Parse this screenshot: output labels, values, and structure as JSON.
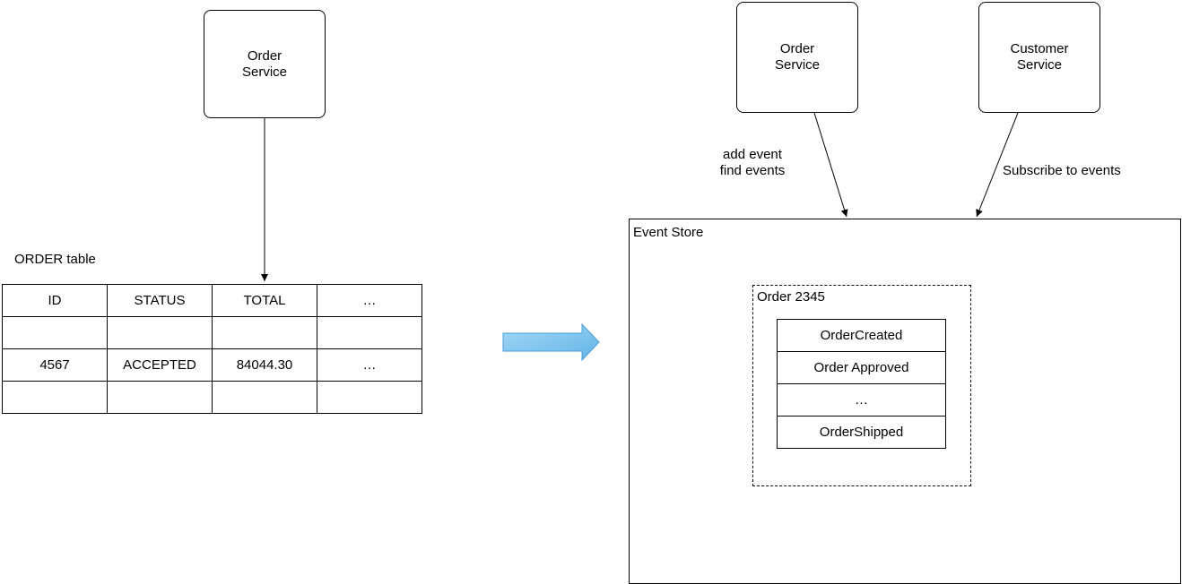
{
  "left": {
    "service": {
      "label": "Order\nService"
    },
    "table": {
      "caption": "ORDER table",
      "header": [
        "ID",
        "STATUS",
        "TOTAL",
        "…"
      ],
      "rows": [
        [
          "",
          "",
          "",
          ""
        ],
        [
          "4567",
          "ACCEPTED",
          "84044.30",
          "…"
        ],
        [
          "",
          "",
          "",
          ""
        ]
      ]
    }
  },
  "transition_arrow": {
    "fill": "#8ecdf3",
    "stroke": "#4a9fd6"
  },
  "right": {
    "order_service": {
      "label": "Order\nService"
    },
    "customer_service": {
      "label": "Customer\nService"
    },
    "edge_order_label": "add event\nfind events",
    "edge_customer_label": "Subscribe to events",
    "event_store": {
      "title": "Event Store",
      "aggregate": {
        "title": "Order 2345",
        "events": [
          "OrderCreated",
          "Order Approved",
          "…",
          "OrderShipped"
        ]
      }
    }
  }
}
